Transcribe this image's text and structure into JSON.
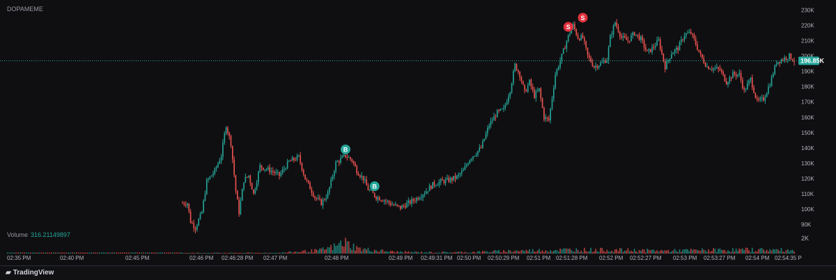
{
  "symbol": "DOPAMEME",
  "volume": {
    "label": "Volume",
    "value": "316.21149897",
    "axis_label": "2K"
  },
  "footer": {
    "brand": "TradingView",
    "brand_icon": "tradingview-logo-icon"
  },
  "colors": {
    "up": "#26a69a",
    "down": "#ef5350",
    "buy": "#26a69a",
    "sell": "#e0303c",
    "price_tag": "#26a69a"
  },
  "chart_data": {
    "type": "candlestick",
    "title": "",
    "xlabel": "",
    "ylabel": "",
    "ylim": [
      86000,
      232000
    ],
    "y_ticks": [
      "230K",
      "220K",
      "210K",
      "200K",
      "190K",
      "180K",
      "170K",
      "160K",
      "150K",
      "140K",
      "130K",
      "120K",
      "110K",
      "100K",
      "90K"
    ],
    "x_ticks": [
      "02:35 PM",
      "02:40 PM",
      "02:45 PM",
      "02:46 PM",
      "02:46:28 PM",
      "02:47 PM",
      "02:48 PM",
      "02:49 PM",
      "02:49:31 PM",
      "02:50 PM",
      "02:50:29 PM",
      "02:51 PM",
      "02:51:28 PM",
      "02:52 PM",
      "02:52:27 PM",
      "02:53 PM",
      "02:53:27 PM",
      "02:54 PM",
      "02:54:35 P"
    ],
    "last_price": {
      "label": "196.85K",
      "value": 196850
    },
    "price_path": [
      [
        0,
        104000
      ],
      [
        3,
        104000
      ],
      [
        5,
        92000
      ],
      [
        8,
        88000
      ],
      [
        12,
        98000
      ],
      [
        15,
        118000
      ],
      [
        20,
        125000
      ],
      [
        24,
        135000
      ],
      [
        27,
        155000
      ],
      [
        30,
        143000
      ],
      [
        33,
        112000
      ],
      [
        35,
        98000
      ],
      [
        38,
        119000
      ],
      [
        41,
        122000
      ],
      [
        44,
        110000
      ],
      [
        48,
        128000
      ],
      [
        55,
        125000
      ],
      [
        60,
        122000
      ],
      [
        66,
        131000
      ],
      [
        72,
        134000
      ],
      [
        76,
        120000
      ],
      [
        82,
        108000
      ],
      [
        86,
        104000
      ],
      [
        90,
        110000
      ],
      [
        95,
        130000
      ],
      [
        101,
        135000
      ],
      [
        105,
        132000
      ],
      [
        108,
        125000
      ],
      [
        112,
        120000
      ],
      [
        115,
        113000
      ],
      [
        120,
        108000
      ],
      [
        125,
        106000
      ],
      [
        130,
        103000
      ],
      [
        135,
        101000
      ],
      [
        140,
        104000
      ],
      [
        145,
        107000
      ],
      [
        150,
        111000
      ],
      [
        155,
        116000
      ],
      [
        160,
        118000
      ],
      [
        165,
        119000
      ],
      [
        170,
        121000
      ],
      [
        174,
        125000
      ],
      [
        178,
        133000
      ],
      [
        182,
        137000
      ],
      [
        185,
        140000
      ],
      [
        190,
        155000
      ],
      [
        195,
        163000
      ],
      [
        199,
        165000
      ],
      [
        203,
        178000
      ],
      [
        206,
        194000
      ],
      [
        209,
        188000
      ],
      [
        212,
        176000
      ],
      [
        215,
        183000
      ],
      [
        218,
        174000
      ],
      [
        221,
        178000
      ],
      [
        224,
        160000
      ],
      [
        227,
        158000
      ],
      [
        231,
        188000
      ],
      [
        235,
        200000
      ],
      [
        239,
        213000
      ],
      [
        242,
        220000
      ],
      [
        245,
        212000
      ],
      [
        248,
        212000
      ],
      [
        251,
        200000
      ],
      [
        255,
        193000
      ],
      [
        259,
        195000
      ],
      [
        263,
        198000
      ],
      [
        265,
        212000
      ],
      [
        268,
        222000
      ],
      [
        272,
        212000
      ],
      [
        276,
        210000
      ],
      [
        280,
        215000
      ],
      [
        284,
        211000
      ],
      [
        288,
        202000
      ],
      [
        291,
        205000
      ],
      [
        295,
        210000
      ],
      [
        299,
        193000
      ],
      [
        303,
        202000
      ],
      [
        307,
        205000
      ],
      [
        311,
        214000
      ],
      [
        315,
        215000
      ],
      [
        318,
        208000
      ],
      [
        321,
        200000
      ],
      [
        325,
        193000
      ],
      [
        329,
        192000
      ],
      [
        333,
        191000
      ],
      [
        337,
        183000
      ],
      [
        341,
        188000
      ],
      [
        345,
        188000
      ],
      [
        348,
        177000
      ],
      [
        352,
        185000
      ],
      [
        356,
        170000
      ],
      [
        360,
        172000
      ],
      [
        364,
        182000
      ],
      [
        368,
        196000
      ],
      [
        372,
        198000
      ],
      [
        376,
        200000
      ],
      [
        379,
        196850
      ]
    ],
    "markers": [
      {
        "label": "B",
        "type": "buy",
        "index": 101,
        "value": 139000
      },
      {
        "label": "B",
        "type": "buy",
        "index": 119,
        "value": 115000
      },
      {
        "label": "S",
        "type": "sell",
        "index": 239,
        "value": 219000
      },
      {
        "label": "S",
        "type": "sell",
        "index": 248,
        "value": 225000
      }
    ],
    "volume_profile": [
      [
        0,
        0.05
      ],
      [
        60,
        0.06
      ],
      [
        85,
        0.25
      ],
      [
        90,
        0.4
      ],
      [
        95,
        0.55
      ],
      [
        100,
        0.9
      ],
      [
        105,
        0.6
      ],
      [
        110,
        0.35
      ],
      [
        115,
        0.3
      ],
      [
        120,
        0.25
      ],
      [
        130,
        0.15
      ],
      [
        140,
        0.12
      ],
      [
        160,
        0.1
      ],
      [
        180,
        0.12
      ],
      [
        200,
        0.2
      ],
      [
        220,
        0.25
      ],
      [
        240,
        0.3
      ],
      [
        260,
        0.28
      ],
      [
        280,
        0.25
      ],
      [
        300,
        0.22
      ],
      [
        320,
        0.26
      ],
      [
        340,
        0.28
      ],
      [
        360,
        0.3
      ],
      [
        379,
        0.25
      ]
    ]
  }
}
